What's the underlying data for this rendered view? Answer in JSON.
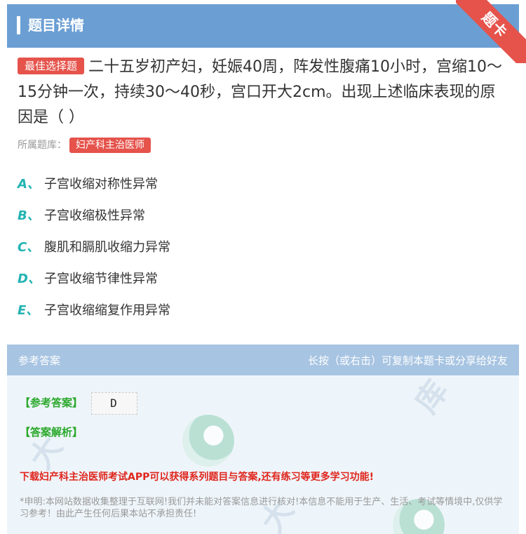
{
  "header": {
    "title": "题目详情",
    "corner_badge": "题卡"
  },
  "question": {
    "type_badge": "最佳选择题",
    "text": "二十五岁初产妇，妊娠40周，阵发性腹痛10小时，宫缩10～15分钟一次，持续30～40秒，宫口开大2cm。出现上述临床表现的原因是（ ）",
    "bank_label": "所属题库：",
    "bank_name": "妇产科主治医师"
  },
  "options": [
    {
      "letter": "A、",
      "text": "子宫收缩对称性异常"
    },
    {
      "letter": "B、",
      "text": "子宫收缩极性异常"
    },
    {
      "letter": "C、",
      "text": "腹肌和膈肌收缩力异常"
    },
    {
      "letter": "D、",
      "text": "子宫收缩节律性异常"
    },
    {
      "letter": "E、",
      "text": "子宫收缩缩复作用异常"
    }
  ],
  "answer": {
    "head_left": "参考答案",
    "head_right": "长按（或右击）可复制本题卡或分享给好友",
    "answer_label": "【参考答案】",
    "answer_value": "D",
    "analysis_label": "【答案解析】",
    "promo": "下载妇产科主治医师考试APP可以获得系列题目与答案,还有练习等更多学习功能!",
    "disclaimer": "*申明:本网站数据收集整理于互联网!我们并未能对答案信息进行核对!本信息不能用于生产、生活、考试等情境中,仅供学习参考！由此产生任何后果本站不承担责任!"
  },
  "colors": {
    "header_bg": "#6b9fd4",
    "accent_red": "#e5534b",
    "option_letter": "#23b3b3",
    "answer_green": "#2aa82a",
    "promo_red": "#e0251c"
  }
}
